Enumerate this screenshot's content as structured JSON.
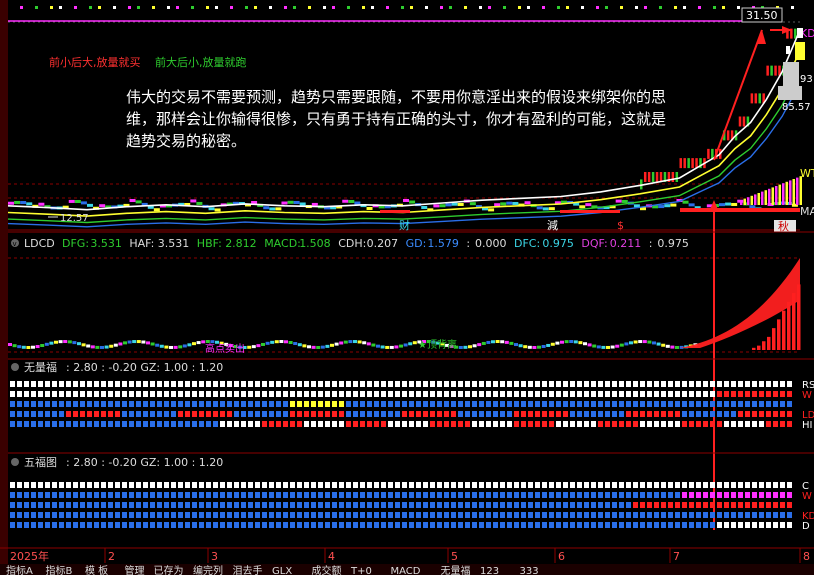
{
  "price_top": "31.50",
  "right_labels": {
    "kd": "KD",
    "p93": "93",
    "p857": "85.57",
    "wt": "WT",
    "ma": "MA"
  },
  "signals": {
    "buy": "前小后大,放量就买",
    "run": "前大后小,放量就跑"
  },
  "quote": [
    "伟大的交易不需要预测，趋势只需要跟随，不要用你意淫出来的假设来绑架你的思",
    "维，那样会让你输得很惨，只有勇于持有正确的头寸，你才有盈利的可能，这就是",
    "趋势交易的秘密。"
  ],
  "low_price": "12.57",
  "markers": {
    "cai": "财",
    "jian": "減",
    "dollar": "$",
    "qiu": "秋"
  },
  "panel2": {
    "name": "LDCD",
    "fields": [
      {
        "k": "DFG:",
        "v": "3.531",
        "color": "#2ecc2e"
      },
      {
        "k": "HAF:",
        "v": "3.531",
        "color": "#dddddd"
      },
      {
        "k": "HBF:",
        "v": "2.812",
        "color": "#2ecc2e"
      },
      {
        "k": "MACD:",
        "v": "1.508",
        "color": "#2ecc2e"
      },
      {
        "k": "CDH:",
        "v": "0.207",
        "color": "#dddddd"
      },
      {
        "k": "GD:",
        "v": "1.579",
        "color": "#3b8cff"
      },
      {
        "k": ":",
        "v": "0.000",
        "color": "#dddddd"
      },
      {
        "k": "DFC:",
        "v": "0.975",
        "color": "#3bd6e6"
      },
      {
        "k": "DQF:",
        "v": "0.211",
        "color": "#e040e0"
      },
      {
        "k": ":",
        "v": "0.975",
        "color": "#dddddd"
      }
    ],
    "overlay_left": "高点卖出",
    "overlay_mid": "★顶背离"
  },
  "panel3": {
    "name": "无量福",
    "params": ": 2.80 : -0.20 GZ: 1.00 : 1.20",
    "right": [
      "RS",
      "W",
      "",
      "LD",
      "HI"
    ]
  },
  "panel4": {
    "name": "五福图",
    "params": ": 2.80 : -0.20 GZ: 1.00 : 1.20",
    "right": [
      "C",
      "W",
      "",
      "KD",
      "D"
    ]
  },
  "axis": {
    "year": "2025年",
    "months": [
      "2",
      "3",
      "4",
      "5",
      "6",
      "7",
      "8"
    ]
  },
  "tabs": [
    "指标A",
    "指标B",
    "模 板",
    "管理",
    "已存为",
    "编完列",
    "泪去手",
    "GLX",
    "成交额",
    "T+0",
    "MACD",
    "无量福",
    "123",
    "333"
  ],
  "colors": {
    "red": "#ff2020",
    "yellow": "#ffff30",
    "blue": "#2a6ee8",
    "white": "#ffffff",
    "magenta": "#ff30ff",
    "green": "#2ecc2e",
    "grid": "#8b0000"
  },
  "chart_data": {
    "type": "line",
    "price_path": [
      [
        0,
        13.0
      ],
      [
        0.05,
        12.8
      ],
      [
        0.1,
        12.57
      ],
      [
        0.15,
        12.9
      ],
      [
        0.2,
        13.1
      ],
      [
        0.25,
        12.9
      ],
      [
        0.3,
        13.2
      ],
      [
        0.35,
        13.0
      ],
      [
        0.4,
        12.9
      ],
      [
        0.45,
        13.1
      ],
      [
        0.5,
        13.0
      ],
      [
        0.55,
        13.3
      ],
      [
        0.6,
        13.6
      ],
      [
        0.65,
        13.8
      ],
      [
        0.7,
        14.0
      ],
      [
        0.75,
        14.5
      ],
      [
        0.8,
        15.2
      ],
      [
        0.85,
        16.0
      ],
      [
        0.88,
        17.5
      ],
      [
        0.9,
        18.5
      ],
      [
        0.92,
        20.5
      ],
      [
        0.94,
        22.0
      ],
      [
        0.96,
        24.5
      ],
      [
        0.98,
        27.5
      ],
      [
        1.0,
        31.5
      ]
    ],
    "y_range": [
      12.0,
      32.0
    ],
    "macd_hist_end": [
      0.05,
      0.1,
      0.2,
      0.3,
      0.5,
      0.7,
      0.9,
      1.1,
      1.3,
      1.5
    ],
    "x_labels": [
      "2025年",
      "2",
      "3",
      "4",
      "5",
      "6",
      "7",
      "8"
    ]
  }
}
